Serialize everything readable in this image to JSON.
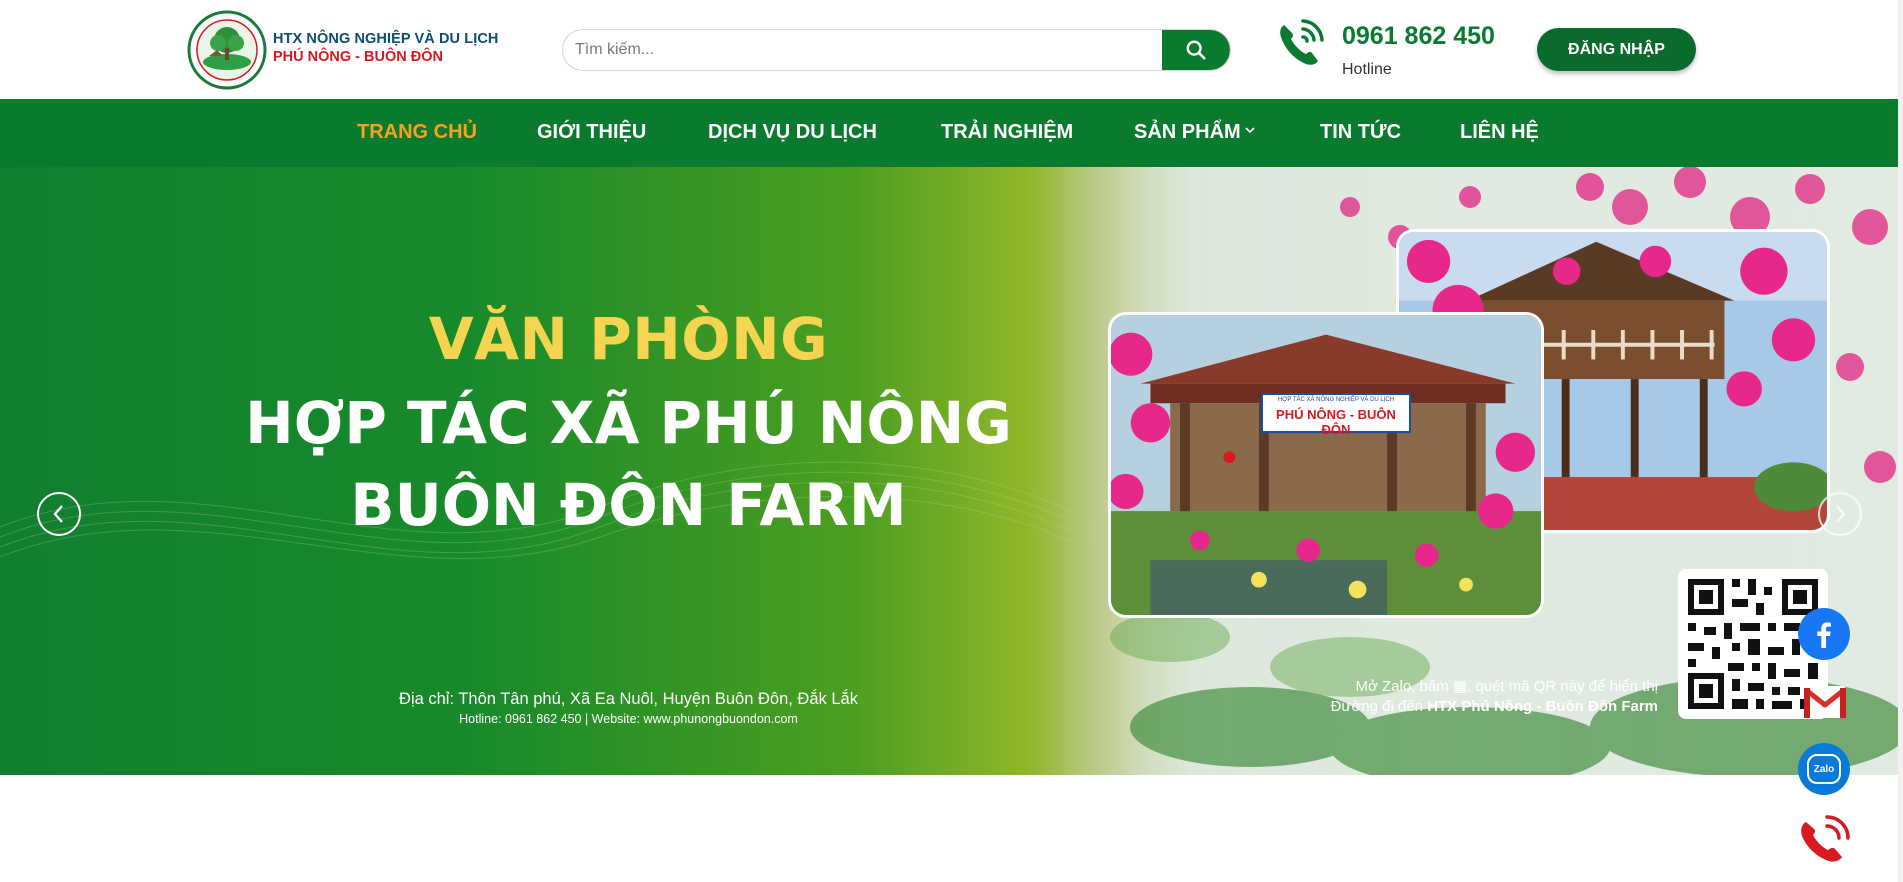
{
  "header": {
    "brand_line1": "HTX NÔNG NGHIỆP VÀ DU LỊCH",
    "brand_line2": "PHÚ NÔNG - BUÔN ĐÔN",
    "search_placeholder": "Tìm kiếm...",
    "hotline_number": "0961 862 450",
    "hotline_label": "Hotline",
    "login_label": "ĐĂNG NHẬP"
  },
  "nav": {
    "items": [
      {
        "label": "TRANG CHỦ",
        "active": true
      },
      {
        "label": "GIỚI THIỆU"
      },
      {
        "label": "DỊCH VỤ DU LỊCH"
      },
      {
        "label": "TRẢI NGHIỆM"
      },
      {
        "label": "SẢN PHẨM"
      },
      {
        "label": "TIN TỨC"
      },
      {
        "label": "LIÊN HỆ"
      }
    ]
  },
  "banner": {
    "headline1": "VĂN PHÒNG",
    "headline2": "HỢP TÁC XÃ PHÚ NÔNG",
    "headline3": "BUÔN ĐÔN FARM",
    "address": "Địa chỉ: Thôn Tân phú, Xã Ea Nuôl, Huyện Buôn Đôn, Đắk Lắk",
    "contact": "Hotline: 0961 862 450  |  Website: www.phunongbuondon.com",
    "qr_note1": "Mở Zalo, bấm ▦, quét mã QR này để hiển thị",
    "qr_note2_prefix": "Đường đi đến ",
    "qr_note2_bold": "HTX Phú Nông - Buôn Đôn Farm",
    "sign_small": "HỢP TÁC XÃ NÔNG NGHIỆP VÀ DU LỊCH",
    "sign_big": "PHÚ NÔNG - BUÔN ĐÔN"
  },
  "floating": {
    "zalo_label": "Zalo"
  },
  "icons": {
    "logo": "cooperative-logo",
    "search": "search-icon",
    "phone": "phone-icon",
    "prev": "chevron-left-icon",
    "next": "chevron-right-icon",
    "facebook": "facebook-icon",
    "gmail": "gmail-icon",
    "zalo": "zalo-icon",
    "call": "call-icon"
  },
  "colors": {
    "primary_green": "#0a7a2f",
    "active_orange": "#f7a21b",
    "headline_yellow": "#f4d451",
    "brand_blue": "#0e4c72",
    "brand_red": "#d71920"
  }
}
